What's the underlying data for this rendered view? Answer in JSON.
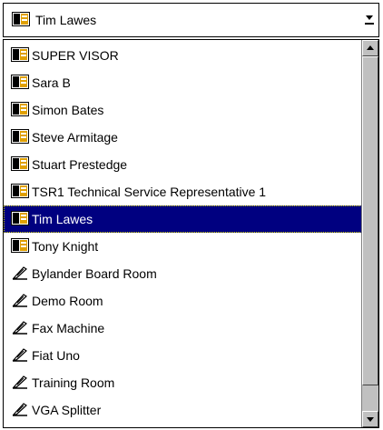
{
  "combo": {
    "value": "Tim Lawes",
    "value_icon": "person-card-icon",
    "arrow_icon": "scroll-down-arrow-icon"
  },
  "list": {
    "items": [
      {
        "label": "SUPER VISOR",
        "icon": "person-card-icon",
        "selected": false
      },
      {
        "label": "Sara B",
        "icon": "person-card-icon",
        "selected": false
      },
      {
        "label": "Simon Bates",
        "icon": "person-card-icon",
        "selected": false
      },
      {
        "label": "Steve Armitage",
        "icon": "person-card-icon",
        "selected": false
      },
      {
        "label": "Stuart Prestedge",
        "icon": "person-card-icon",
        "selected": false
      },
      {
        "label": "TSR1 Technical Service Representative 1",
        "icon": "person-card-icon",
        "selected": false
      },
      {
        "label": "Tim Lawes",
        "icon": "person-card-icon",
        "selected": true
      },
      {
        "label": "Tony Knight",
        "icon": "person-card-icon",
        "selected": false
      },
      {
        "label": "Bylander Board Room",
        "icon": "quill-resource-icon",
        "selected": false
      },
      {
        "label": "Demo Room",
        "icon": "quill-resource-icon",
        "selected": false
      },
      {
        "label": "Fax Machine",
        "icon": "quill-resource-icon",
        "selected": false
      },
      {
        "label": "Fiat Uno",
        "icon": "quill-resource-icon",
        "selected": false
      },
      {
        "label": "Training Room",
        "icon": "quill-resource-icon",
        "selected": false
      },
      {
        "label": "VGA Splitter",
        "icon": "quill-resource-icon",
        "selected": false
      }
    ]
  },
  "scrollbar": {
    "up_icon": "scroll-up-arrow-icon",
    "down_icon": "scroll-down-arrow-icon"
  },
  "colors": {
    "selection_bg": "#000080",
    "scrollbar_face": "#c0c0c0"
  }
}
